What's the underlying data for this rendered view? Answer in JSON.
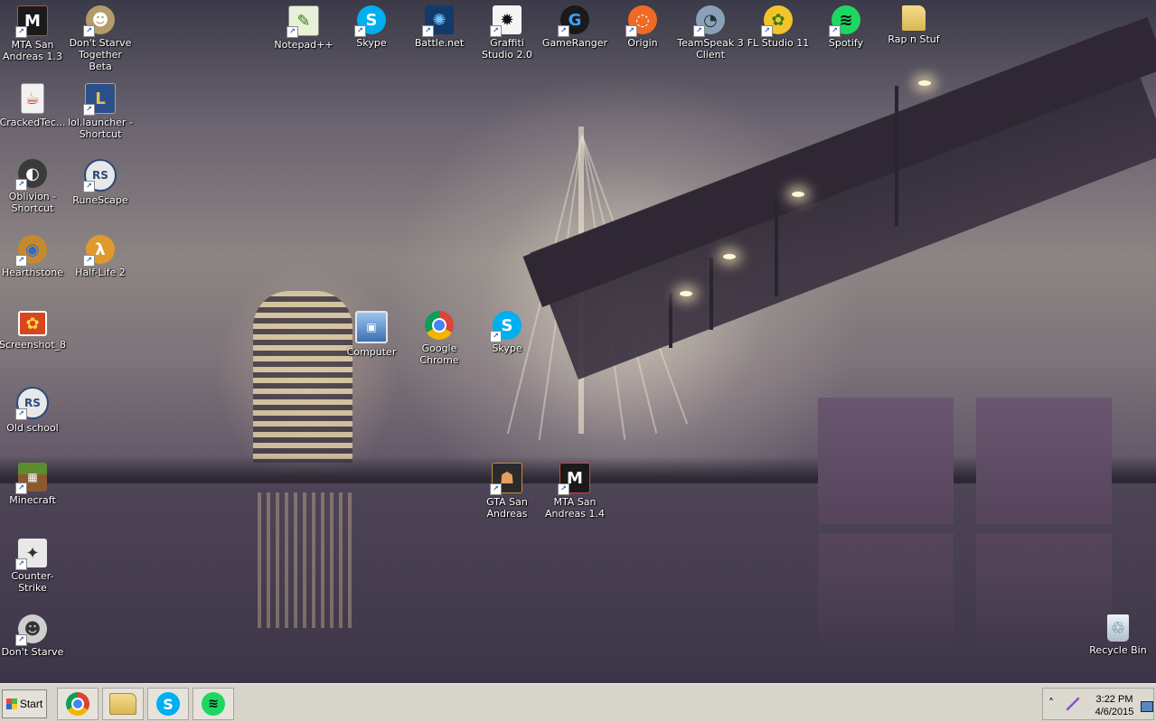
{
  "desktop_icons": [
    {
      "label": "MTA San Andreas 1.3",
      "icon": "mta-icon",
      "color": "#1a1a1a",
      "glyph": "M"
    },
    {
      "label": "Don't Starve Together Beta",
      "icon": "dont-starve-together-icon",
      "color": "#b39c6a",
      "glyph": "☻"
    },
    {
      "label": "CrackedTec...",
      "icon": "java-file-icon",
      "color": "#f2f2f2",
      "glyph": "☕"
    },
    {
      "label": "lol.launcher - Shortcut",
      "icon": "league-of-legends-icon",
      "color": "#2a4f8a",
      "glyph": "L"
    },
    {
      "label": "Oblivion - Shortcut",
      "icon": "oblivion-icon",
      "color": "#3a3a3a",
      "glyph": "◐"
    },
    {
      "label": "RuneScape",
      "icon": "runescape-icon",
      "color": "#e8e8e8",
      "glyph": "RS"
    },
    {
      "label": "Hearthstone",
      "icon": "hearthstone-icon",
      "color": "#c68a2e",
      "glyph": "◉"
    },
    {
      "label": "Half-Life 2",
      "icon": "half-life-2-icon",
      "color": "#e09a2c",
      "glyph": "λ"
    },
    {
      "label": "Screenshot_8",
      "icon": "image-file-icon",
      "color": "#d9451f",
      "glyph": "✿"
    },
    {
      "label": "Old school",
      "icon": "runescape-old-school-icon",
      "color": "#e8e8e8",
      "glyph": "RS"
    },
    {
      "label": "Minecraft",
      "icon": "minecraft-icon",
      "color": "#5b8c2d",
      "glyph": "▦"
    },
    {
      "label": "Counter-Strike",
      "icon": "counter-strike-icon",
      "color": "#e8e8e8",
      "glyph": "✦"
    },
    {
      "label": "Don't Starve",
      "icon": "dont-starve-icon",
      "color": "#cfcfcf",
      "glyph": "☻"
    },
    {
      "label": "Notepad++",
      "icon": "notepad-plus-plus-icon",
      "color": "#e8f0d8",
      "glyph": "✎"
    },
    {
      "label": "Skype",
      "icon": "skype-icon",
      "color": "#00aff0",
      "glyph": "S"
    },
    {
      "label": "Battle.net",
      "icon": "battlenet-icon",
      "color": "#123a6b",
      "glyph": "✺"
    },
    {
      "label": "Graffiti Studio 2.0",
      "icon": "graffiti-studio-icon",
      "color": "#f4f4f4",
      "glyph": "✹"
    },
    {
      "label": "GameRanger",
      "icon": "gameranger-icon",
      "color": "#1a1a1a",
      "glyph": "G"
    },
    {
      "label": "Origin",
      "icon": "origin-icon",
      "color": "#f06a24",
      "glyph": "◌"
    },
    {
      "label": "TeamSpeak 3 Client",
      "icon": "teamspeak-icon",
      "color": "#8aa0b8",
      "glyph": "◔"
    },
    {
      "label": "FL Studio 11",
      "icon": "fl-studio-icon",
      "color": "#f3c42a",
      "glyph": "✿"
    },
    {
      "label": "Spotify",
      "icon": "spotify-icon",
      "color": "#1ed760",
      "glyph": "≋"
    },
    {
      "label": "Rap n Stuf",
      "icon": "folder-icon",
      "color": "#e8cd7a",
      "glyph": ""
    },
    {
      "label": "Computer",
      "icon": "computer-icon",
      "color": "#6d9bd6",
      "glyph": "▣"
    },
    {
      "label": "Google Chrome",
      "icon": "chrome-icon",
      "color": "#e8e8e8",
      "glyph": "◎"
    },
    {
      "label": "Skype",
      "icon": "skype-icon",
      "color": "#00aff0",
      "glyph": "S"
    },
    {
      "label": "GTA San Andreas",
      "icon": "gta-san-andreas-icon",
      "color": "#2b2b2b",
      "glyph": "☗"
    },
    {
      "label": "MTA San Andreas 1.4",
      "icon": "mta-icon",
      "color": "#1a1a1a",
      "glyph": "M"
    },
    {
      "label": "Recycle Bin",
      "icon": "recycle-bin-icon",
      "color": "#d9e2ea",
      "glyph": "♲"
    }
  ],
  "taskbar": {
    "start_label": "Start",
    "pinned": [
      {
        "name": "chrome",
        "icon": "chrome-icon"
      },
      {
        "name": "explorer",
        "icon": "file-explorer-icon"
      },
      {
        "name": "skype",
        "icon": "skype-icon"
      },
      {
        "name": "spotify",
        "icon": "spotify-icon"
      }
    ],
    "tray": {
      "overflow": "˄",
      "time": "3:22 PM",
      "date": "4/6/2015"
    }
  }
}
